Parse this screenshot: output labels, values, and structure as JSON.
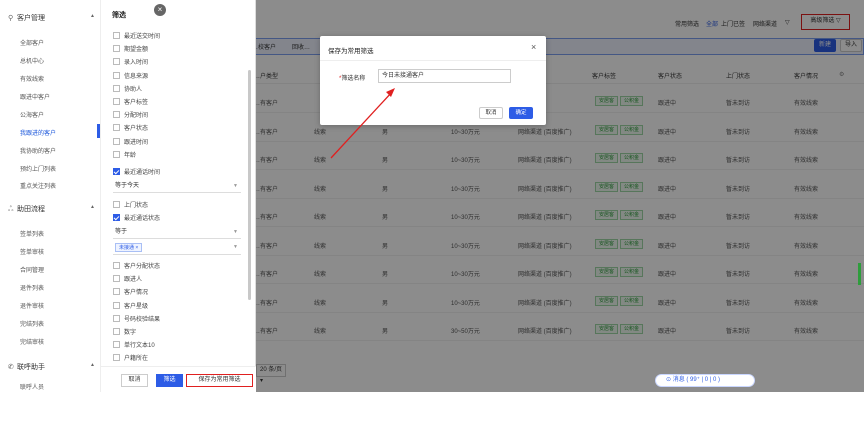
{
  "nav": {
    "groups": [
      {
        "label": "客户管理",
        "icon": "search-icon"
      },
      {
        "label": "助田流程",
        "icon": "flow-icon"
      },
      {
        "label": "联呼助手",
        "icon": "phone-icon"
      }
    ],
    "customer_items": [
      "全部客户",
      "总机中心",
      "有效线索",
      "跟进中客户",
      "公海客户",
      "我跟进的客户",
      "我协助的客户",
      "预约上门列表",
      "重点关注列表"
    ],
    "flow_items": [
      "签单列表",
      "签单审核",
      "合同管理",
      "退件列表",
      "退件审核",
      "完结列表",
      "完结审核"
    ],
    "bottom_item": "联呼人员",
    "active_item": "我跟进的客户"
  },
  "topbar": {
    "common_filter": "常用筛选",
    "all": "全部",
    "visited": "上门已签",
    "channel": "网络渠道",
    "advanced_filter": "高级筛选"
  },
  "tabs": [
    "…校客户",
    "回收…"
  ],
  "actions": {
    "new": "新建",
    "import": "导入"
  },
  "table": {
    "headers": [
      "…户类型",
      "客户标签",
      "客户状态",
      "上门状态",
      "客户情况"
    ],
    "rows": [
      {
        "type": "…有客户",
        "col2": "",
        "col3": "",
        "budget": "",
        "channel": "",
        "tags": [
          "安居客",
          "公积金"
        ],
        "status": "跟进中",
        "visit": "暂未到访",
        "result": "有效线索"
      },
      {
        "type": "…有客户",
        "col2": "线索",
        "col3": "男",
        "budget": "10~30万元",
        "channel": "网络渠道 (百度推广)",
        "tags": [
          "安居客",
          "公积金"
        ],
        "status": "跟进中",
        "visit": "暂未到访",
        "result": "有效线索"
      },
      {
        "type": "…有客户",
        "col2": "线索",
        "col3": "男",
        "budget": "10~30万元",
        "channel": "网络渠道 (百度推广)",
        "tags": [
          "安居客",
          "公积金"
        ],
        "status": "跟进中",
        "visit": "暂未到访",
        "result": "有效线索"
      },
      {
        "type": "…有客户",
        "col2": "线索",
        "col3": "男",
        "budget": "10~30万元",
        "channel": "网络渠道 (百度推广)",
        "tags": [
          "安居客",
          "公积金"
        ],
        "status": "跟进中",
        "visit": "暂未到访",
        "result": "有效线索"
      },
      {
        "type": "…有客户",
        "col2": "线索",
        "col3": "男",
        "budget": "10~30万元",
        "channel": "网络渠道 (百度推广)",
        "tags": [
          "安居客",
          "公积金"
        ],
        "status": "跟进中",
        "visit": "暂未到访",
        "result": "有效线索"
      },
      {
        "type": "…有客户",
        "col2": "线索",
        "col3": "男",
        "budget": "10~30万元",
        "channel": "网络渠道 (百度推广)",
        "tags": [
          "安居客",
          "公积金"
        ],
        "status": "跟进中",
        "visit": "暂未到访",
        "result": "有效线索"
      },
      {
        "type": "…有客户",
        "col2": "线索",
        "col3": "男",
        "budget": "10~30万元",
        "channel": "网络渠道 (百度推广)",
        "tags": [
          "安居客",
          "公积金"
        ],
        "status": "跟进中",
        "visit": "暂未到访",
        "result": "有效线索"
      },
      {
        "type": "…有客户",
        "col2": "线索",
        "col3": "男",
        "budget": "10~30万元",
        "channel": "网络渠道 (百度推广)",
        "tags": [
          "安居客",
          "公积金"
        ],
        "status": "跟进中",
        "visit": "暂未到访",
        "result": "有效线索"
      },
      {
        "type": "…有客户",
        "col2": "线索",
        "col3": "男",
        "budget": "30~50万元",
        "channel": "网络渠道 (百度推广)",
        "tags": [
          "安居客",
          "公积金"
        ],
        "status": "跟进中",
        "visit": "暂未到访",
        "result": "有效线索"
      }
    ]
  },
  "pager": {
    "size": "20 条/页"
  },
  "message": {
    "label": "消息 ( 99⁺ | 0 | 0 )"
  },
  "filter_panel": {
    "title": "筛选",
    "items_top": [
      "最近送交时间",
      "期望金额",
      "录入时间",
      "信息来源",
      "协助人",
      "客户标签",
      "分配时间",
      "客户状态",
      "跟进时间",
      "年龄"
    ],
    "recent_call_time": {
      "label": "最近通话时间",
      "value": "等于今天",
      "checked": true
    },
    "visit_status": {
      "label": "上门状态"
    },
    "recent_call_status": {
      "label": "最近通话状态",
      "op": "等于",
      "chip": "未接通",
      "checked": true
    },
    "items_bottom": [
      "客户分配状态",
      "跟进人",
      "客户情况",
      "客户星级",
      "号码校验结果",
      "数字",
      "单行文本10",
      "户籍所在"
    ],
    "buttons": {
      "cancel": "取消",
      "filter": "筛选",
      "save": "保存为常用筛选"
    }
  },
  "modal": {
    "title": "保存为常用筛选",
    "field_label": "筛选名称",
    "required_mark": "*",
    "value": "今日未接通客户",
    "cancel": "取消",
    "confirm": "确定"
  }
}
